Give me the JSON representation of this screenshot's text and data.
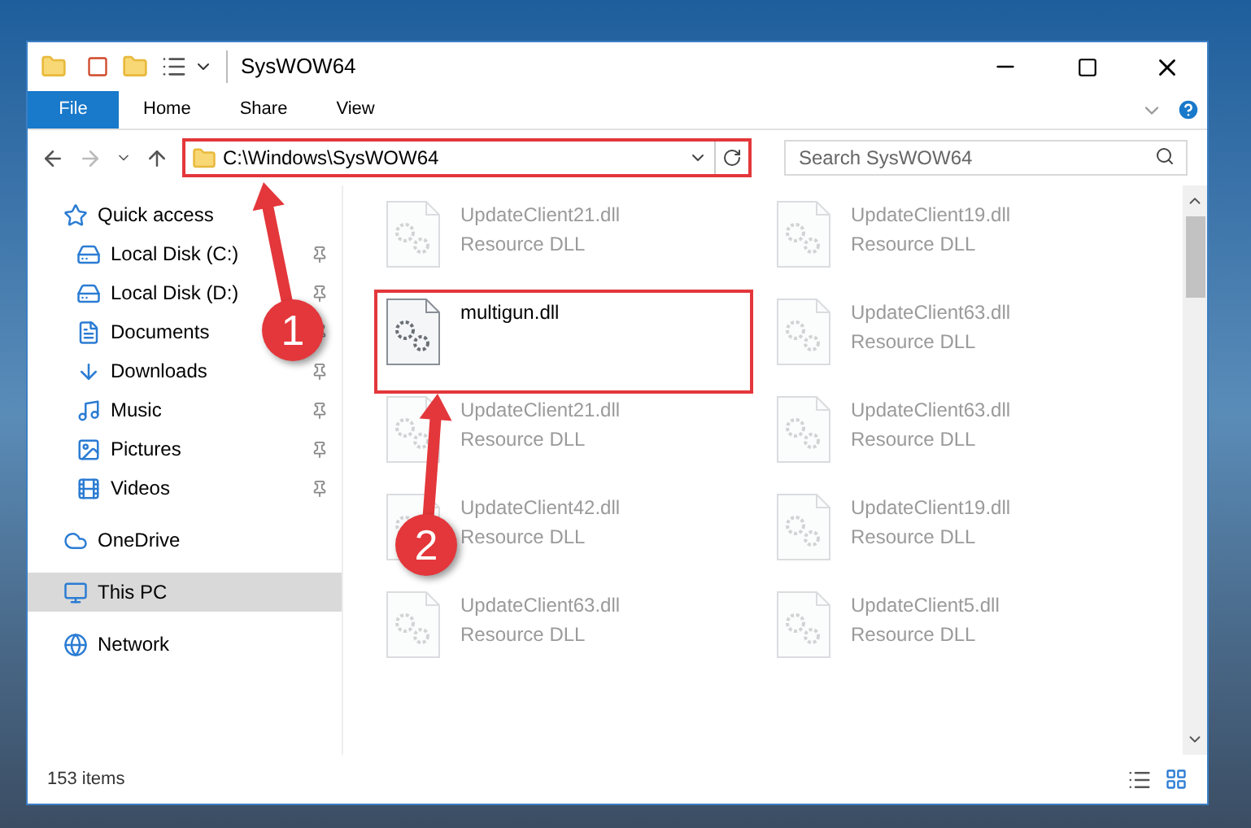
{
  "window": {
    "title": "SysWOW64"
  },
  "ribbon_tabs": [
    {
      "label": "File",
      "selected": true
    },
    {
      "label": "Home",
      "selected": false
    },
    {
      "label": "Share",
      "selected": false
    },
    {
      "label": "View",
      "selected": false
    }
  ],
  "address": {
    "path": "C:\\Windows\\SysWOW64",
    "highlighted": true
  },
  "search": {
    "placeholder": "Search SysWOW64"
  },
  "sidebar": {
    "items": [
      {
        "label": "Quick access",
        "selected": false,
        "children": [
          {
            "label": "Local Disk (C:)",
            "pinned": true,
            "selected": false
          },
          {
            "label": "Local Disk (D:)",
            "pinned": true,
            "selected": false
          },
          {
            "label": "Documents",
            "pinned": true,
            "selected": false
          },
          {
            "label": "Downloads",
            "pinned": true,
            "selected": false
          },
          {
            "label": "Music",
            "pinned": true,
            "selected": false
          },
          {
            "label": "Pictures",
            "pinned": true,
            "selected": false
          },
          {
            "label": "Videos",
            "pinned": true,
            "selected": false
          }
        ]
      },
      {
        "label": "OneDrive",
        "selected": false
      },
      {
        "label": "This PC",
        "selected": true
      },
      {
        "label": "Network",
        "selected": false
      }
    ]
  },
  "files": [
    {
      "name": "UpdateClient21.dll",
      "type": "Resource DLL",
      "blurred": true,
      "highlighted": false
    },
    {
      "name": "UpdateClient19.dll",
      "type": "Resource DLL",
      "blurred": true,
      "highlighted": false
    },
    {
      "name": "multigun.dll",
      "blurred": false,
      "highlighted": true
    },
    {
      "name": "UpdateClient63.dll",
      "type": "Resource DLL",
      "blurred": true,
      "highlighted": false
    },
    {
      "name": "UpdateClient21.dll",
      "type": "Resource DLL",
      "blurred": true,
      "highlighted": false
    },
    {
      "name": "UpdateClient63.dll",
      "type": "Resource DLL",
      "blurred": true,
      "highlighted": false
    },
    {
      "name": "UpdateClient42.dll",
      "type": "Resource DLL",
      "blurred": true,
      "highlighted": false
    },
    {
      "name": "UpdateClient19.dll",
      "type": "Resource DLL",
      "blurred": true,
      "highlighted": false
    },
    {
      "name": "UpdateClient63.dll",
      "type": "Resource DLL",
      "blurred": true,
      "highlighted": false
    },
    {
      "name": "UpdateClient5.dll",
      "type": "Resource DLL",
      "blurred": true,
      "highlighted": false
    }
  ],
  "status_bar": {
    "item_count": "153 items"
  },
  "annotations": [
    {
      "number": "1"
    },
    {
      "number": "2"
    }
  ]
}
